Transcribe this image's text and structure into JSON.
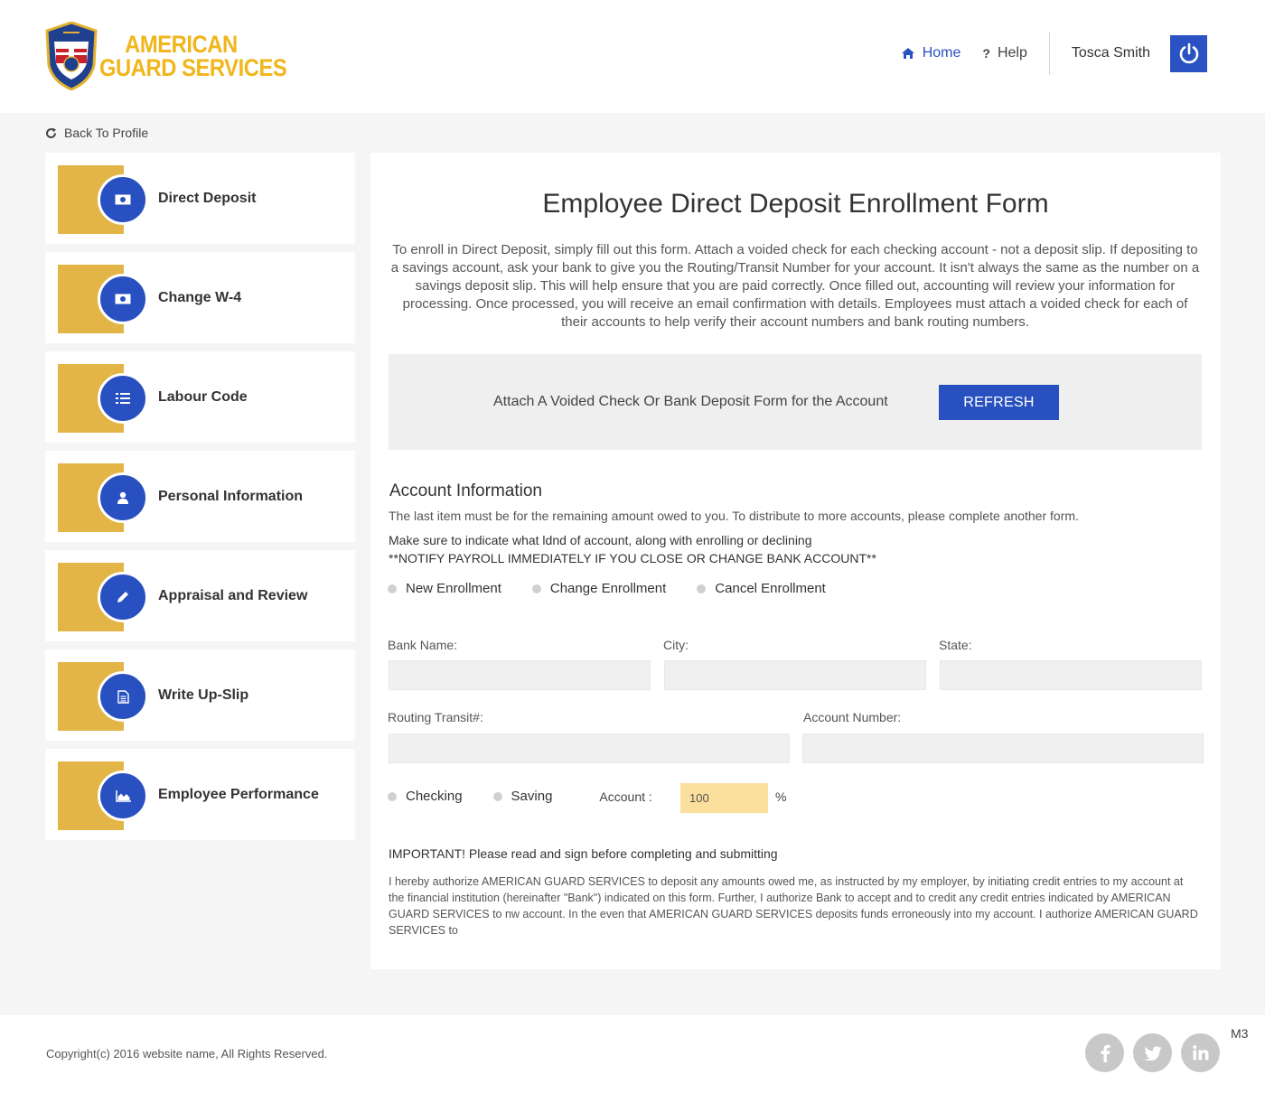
{
  "brand": {
    "line1": "AMERICAN",
    "line2": "GUARD SERVICES",
    "color": "#f0b61b"
  },
  "nav": {
    "home": "Home",
    "help": "Help",
    "user": "Tosca Smith",
    "accent": "#2850c0"
  },
  "back_label": "Back To Profile",
  "sidebar": {
    "items": [
      {
        "label": "Direct Deposit",
        "icon": "money-icon"
      },
      {
        "label": "Change W-4",
        "icon": "money-icon"
      },
      {
        "label": "Labour Code",
        "icon": "list-icon"
      },
      {
        "label": "Personal Information",
        "icon": "user-icon"
      },
      {
        "label": "Appraisal and Review",
        "icon": "pencil-icon"
      },
      {
        "label": "Write Up-Slip",
        "icon": "document-icon"
      },
      {
        "label": "Employee Performance",
        "icon": "area-chart-icon"
      }
    ]
  },
  "form": {
    "title": "Employee Direct Deposit Enrollment Form",
    "intro": "To enroll in Direct Deposit, simply fill out this form. Attach a voided check for each checking account - not a deposit slip. If depositing to a savings account, ask your bank to give you the Routing/Transit Number for your account. It isn't always the same as the number on a savings deposit slip. This will help ensure that you are paid correctly. Once filled out, accounting will review your information for processing. Once processed, you will receive an email confirmation with details. Employees must attach a voided check for each of their accounts to help verify their account numbers and bank routing numbers.",
    "attach_text": "Attach A Voided Check Or Bank Deposit Form for the Account",
    "refresh_label": "REFRESH",
    "account_title": "Account Information",
    "account_note": "The last item must be for the remaining amount owed to you. To distribute to more accounts, please complete another form.",
    "account_note2": "Make sure to indicate what ldnd of account, along with enrolling or declining",
    "account_note3": "**NOTIFY PAYROLL IMMEDIATELY IF YOU CLOSE OR CHANGE BANK ACCOUNT**",
    "enrollment_options": [
      "New Enrollment",
      "Change Enrollment",
      "Cancel Enrollment"
    ],
    "labels": {
      "bank_name": "Bank Name:",
      "city": "City:",
      "state": "State:",
      "routing": "Routing Transit#:",
      "account_number": "Account Number:"
    },
    "values": {
      "bank_name": "",
      "city": "",
      "state": "",
      "routing": "",
      "account_number": ""
    },
    "account_types": [
      "Checking",
      "Saving"
    ],
    "account_label": "Account :",
    "account_percent": "100",
    "percent_sign": "%",
    "important": "IMPORTANT! Please read and sign before completing and submitting",
    "legal": " I hereby authorize AMERICAN GUARD SERVICES to deposit any amounts owed me, as instructed by my employer, by initiating credit entries to my account at the financial institution (hereinafter \"Bank\") indicated on this form. Further, I authorize Bank to accept and to credit any credit entries indicated by AMERICAN GUARD SERVICES to nw account. In the even that AMERICAN GUARD SERVICES deposits funds erroneously into my account. I authorize AMERICAN GUARD SERVICES to"
  },
  "footer": {
    "copyright": "Copyright(c) 2016 website name, All Rights Reserved.",
    "socials": [
      "facebook-icon",
      "twitter-icon",
      "linkedin-icon"
    ],
    "version": "M3"
  }
}
